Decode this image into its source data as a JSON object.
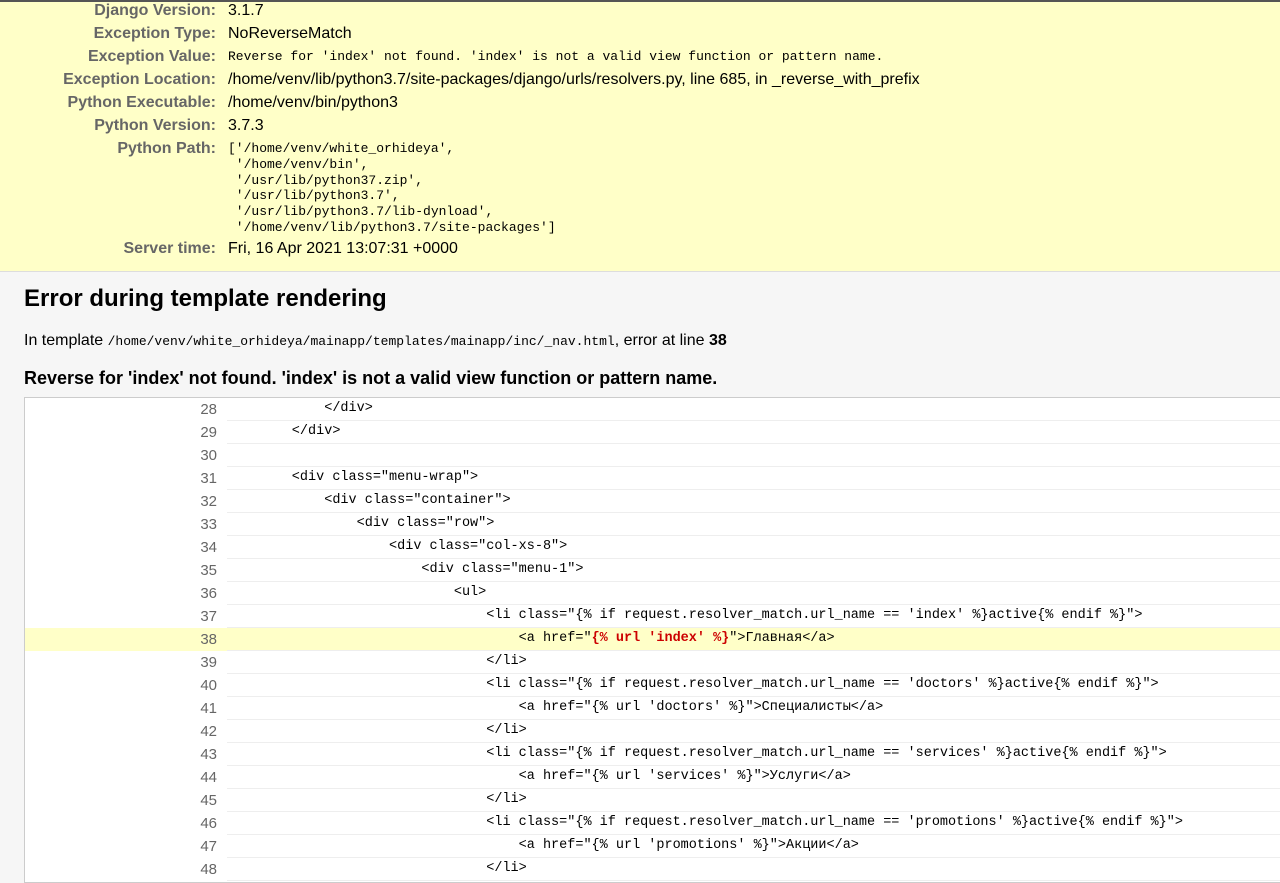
{
  "summary": {
    "rows": [
      {
        "key": "Django Version:",
        "value": "3.1.7"
      },
      {
        "key": "Exception Type:",
        "value": "NoReverseMatch"
      },
      {
        "key": "Exception Value:",
        "value": "Reverse for 'index' not found. 'index' is not a valid view function or pattern name."
      },
      {
        "key": "Exception Location:",
        "value": "/home/venv/lib/python3.7/site-packages/django/urls/resolvers.py, line 685, in _reverse_with_prefix"
      },
      {
        "key": "Python Executable:",
        "value": "/home/venv/bin/python3"
      },
      {
        "key": "Python Version:",
        "value": "3.7.3"
      },
      {
        "key": "Python Path:",
        "value": ""
      },
      {
        "key": "Server time:",
        "value": "Fri, 16 Apr 2021 13:07:31 +0000"
      }
    ],
    "python_path": [
      "['/home/venv/white_orhideya',",
      " '/home/venv/bin',",
      " '/usr/lib/python37.zip',",
      " '/usr/lib/python3.7',",
      " '/usr/lib/python3.7/lib-dynload',",
      " '/home/venv/lib/python3.7/site-packages']"
    ]
  },
  "template_error": {
    "heading": "Error during template rendering",
    "info_prefix": "In template ",
    "template_path": "/home/venv/white_orhideya/mainapp/templates/mainapp/inc/_nav.html",
    "info_middle": ", error at line ",
    "error_line": "38",
    "message": "Reverse for 'index' not found. 'index' is not a valid view function or pattern name."
  },
  "source_lines": [
    {
      "num": "28",
      "code": "            </div>"
    },
    {
      "num": "29",
      "code": "        </div>"
    },
    {
      "num": "30",
      "code": ""
    },
    {
      "num": "31",
      "code": "        <div class=\"menu-wrap\">"
    },
    {
      "num": "32",
      "code": "            <div class=\"container\">"
    },
    {
      "num": "33",
      "code": "                <div class=\"row\">"
    },
    {
      "num": "34",
      "code": "                    <div class=\"col-xs-8\">"
    },
    {
      "num": "35",
      "code": "                        <div class=\"menu-1\">"
    },
    {
      "num": "36",
      "code": "                            <ul>"
    },
    {
      "num": "37",
      "code": "                                <li class=\"{% if request.resolver_match.url_name == 'index' %}active{% endif %}\">"
    },
    {
      "num": "38",
      "code_before": "                                    <a href=\"",
      "code_error": "{% url 'index' %}",
      "code_after": "\">Главная</a>"
    },
    {
      "num": "39",
      "code": "                                </li>"
    },
    {
      "num": "40",
      "code": "                                <li class=\"{% if request.resolver_match.url_name == 'doctors' %}active{% endif %}\">"
    },
    {
      "num": "41",
      "code": "                                    <a href=\"{% url 'doctors' %}\">Специалисты</a>"
    },
    {
      "num": "42",
      "code": "                                </li>"
    },
    {
      "num": "43",
      "code": "                                <li class=\"{% if request.resolver_match.url_name == 'services' %}active{% endif %}\">"
    },
    {
      "num": "44",
      "code": "                                    <a href=\"{% url 'services' %}\">Услуги</a>"
    },
    {
      "num": "45",
      "code": "                                </li>"
    },
    {
      "num": "46",
      "code": "                                <li class=\"{% if request.resolver_match.url_name == 'promotions' %}active{% endif %}\">"
    },
    {
      "num": "47",
      "code": "                                    <a href=\"{% url 'promotions' %}\">Акции</a>"
    },
    {
      "num": "48",
      "code": "                                </li>"
    }
  ]
}
